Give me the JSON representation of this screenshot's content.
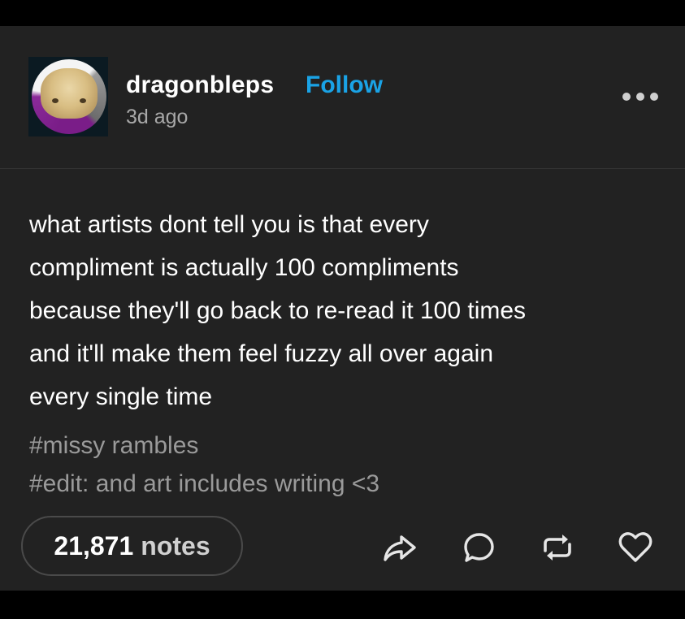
{
  "post": {
    "author": "dragonbleps",
    "follow_label": "Follow",
    "timestamp": "3d ago",
    "body_lines": [
      "what artists dont tell you is that every",
      "compliment is actually 100 compliments",
      "because they'll go back to re-read it 100 times",
      "and it'll make them feel fuzzy all over again",
      "every single time"
    ],
    "tags": [
      "#missy rambles",
      "#edit: and art includes writing <3"
    ],
    "notes_count": "21,871",
    "notes_label": "notes"
  },
  "icons": {
    "avatar": "avatar-bearded-dragon",
    "more": "more-horizontal-icon",
    "share": "share-icon",
    "reply": "reply-icon",
    "reblog": "reblog-icon",
    "like": "heart-icon"
  },
  "colors": {
    "background": "#222222",
    "follow": "#1aa3e6",
    "text": "#ffffff",
    "muted": "#9a9a9a"
  }
}
